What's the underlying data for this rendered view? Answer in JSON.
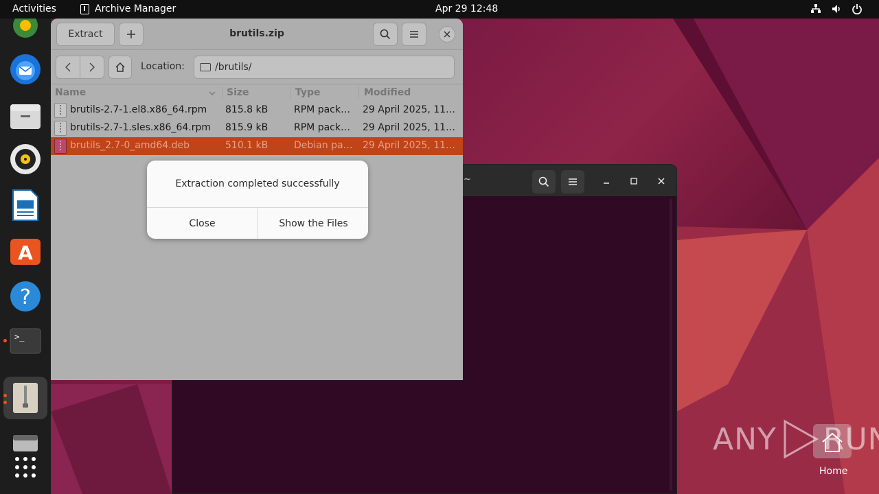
{
  "topbar": {
    "activities": "Activities",
    "app_name": "Archive Manager",
    "clock": "Apr 29  12:48",
    "tray_icons": [
      "network-icon",
      "volume-icon",
      "power-icon"
    ]
  },
  "dock": {
    "items": [
      "chrome",
      "thunderbird",
      "files",
      "rhythmbox",
      "libreoffice-writer",
      "app-center",
      "help",
      "terminal",
      "archive-manager",
      "disk",
      "show-apps"
    ]
  },
  "terminal": {
    "title": "~"
  },
  "archive_manager": {
    "extract_label": "Extract",
    "add_label": "+",
    "title": "brutils.zip",
    "location_label": "Location:",
    "location_value": "/brutils/",
    "columns": {
      "name": "Name",
      "size": "Size",
      "type": "Type",
      "modified": "Modified"
    },
    "files": [
      {
        "name": "brutils-2.7-1.el8.x86_64.rpm",
        "size": "815.8 kB",
        "type": "RPM pack…",
        "modified": "29 April 2025, 11…"
      },
      {
        "name": "brutils-2.7-1.sles.x86_64.rpm",
        "size": "815.9 kB",
        "type": "RPM pack…",
        "modified": "29 April 2025, 11…"
      },
      {
        "name": "brutils_2.7-0_amd64.deb",
        "size": "510.1 kB",
        "type": "Debian pa…",
        "modified": "29 April 2025, 11…"
      }
    ]
  },
  "dialog": {
    "message": "Extraction completed successfully",
    "close_label": "Close",
    "show_files_label": "Show the Files"
  },
  "watermark": {
    "text_left": "ANY",
    "text_right": "RUN"
  },
  "desktop": {
    "home_label": "Home"
  },
  "colors": {
    "accent": "#e95420",
    "selection": "#c0441a",
    "terminal_bg": "#300a24"
  }
}
